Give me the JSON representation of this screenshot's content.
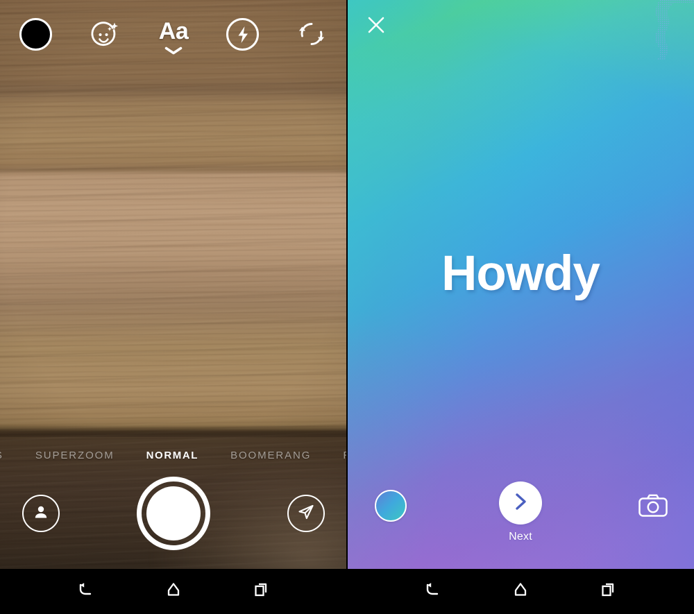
{
  "left_phone": {
    "name": "instagram-camera-screen",
    "top_toolbar": {
      "items": [
        {
          "icon": "filled-circle-icon",
          "label": "Color / Mask"
        },
        {
          "icon": "face-sparkle-icon",
          "label": "Face Effects"
        },
        {
          "icon": "text-format-icon",
          "label": "Aa"
        },
        {
          "icon": "flash-icon",
          "label": "Flash"
        },
        {
          "icon": "camera-flip-icon",
          "label": "Flip Camera"
        }
      ],
      "text_button_label": "Aa",
      "chevron": "chevron-down-icon"
    },
    "mode_strip": {
      "modes": [
        {
          "label": "ES",
          "active": false
        },
        {
          "label": "SUPERZOOM",
          "active": false
        },
        {
          "label": "NORMAL",
          "active": true
        },
        {
          "label": "BOOMERANG",
          "active": false
        },
        {
          "label": "RE",
          "active": false
        }
      ],
      "selected": "NORMAL"
    },
    "bottom_bar": {
      "left_icon": "person-icon",
      "shutter": "shutter-button",
      "right_icon": "send-icon"
    },
    "background": {
      "type": "wood-texture-photo",
      "colors": [
        "#8a6b4b",
        "#b49474",
        "#a4875f",
        "#47372a"
      ]
    }
  },
  "right_phone": {
    "name": "instagram-type-story-screen",
    "close_icon": "close-icon",
    "story_text": "Howdy",
    "background": {
      "type": "gradient",
      "colors": [
        "#42c8b8",
        "#4ecf9a",
        "#3cb4dd",
        "#5d8ad9",
        "#a06fd4"
      ],
      "noise_region": "dither-blob-top-right"
    },
    "bottom_bar": {
      "color_swatch": {
        "icon": "color-picker-icon",
        "colors": [
          "#5f7fd6",
          "#3fa8dd",
          "#3ec7c2"
        ]
      },
      "next_button": {
        "icon": "chevron-right-icon",
        "label": "Next",
        "chevron_color": "#4a5fc0"
      },
      "camera_button": {
        "icon": "camera-icon"
      }
    }
  },
  "navbar": {
    "buttons": [
      {
        "icon": "back-icon",
        "label": "Back"
      },
      {
        "icon": "home-icon",
        "label": "Home"
      },
      {
        "icon": "recents-icon",
        "label": "Recents"
      }
    ],
    "background_color": "#000000"
  }
}
